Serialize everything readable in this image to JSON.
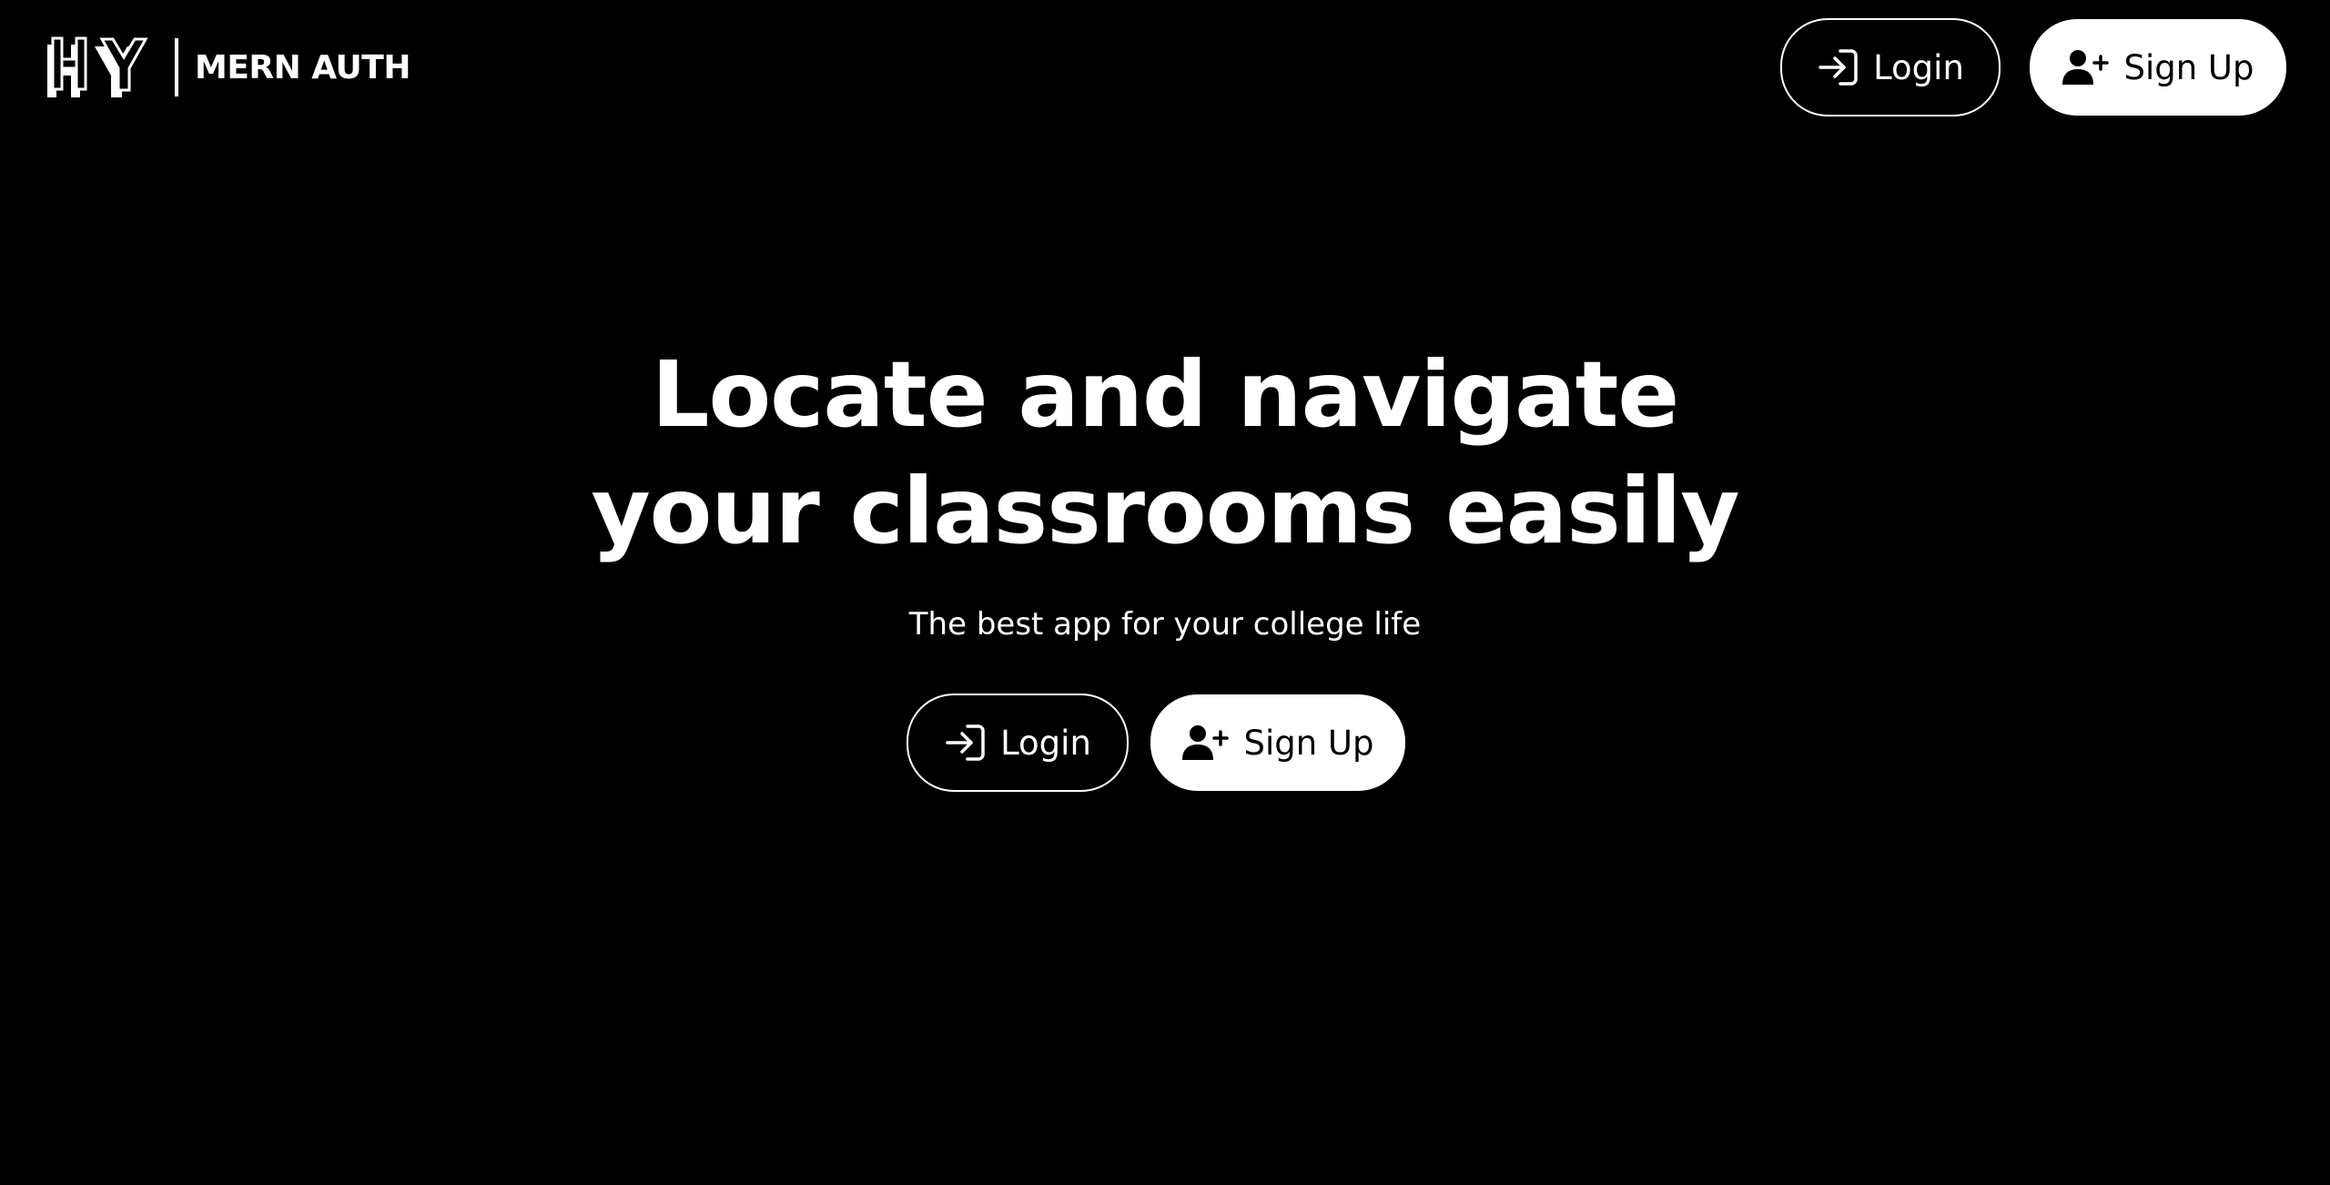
{
  "header": {
    "brand_logo": "HY",
    "brand_name": "MERN AUTH",
    "login_label": "Login",
    "signup_label": "Sign Up",
    "login_icon": "login-icon",
    "signup_icon": "user-plus-icon"
  },
  "hero": {
    "title_line1": "Locate and navigate",
    "title_line2": "your classrooms easily",
    "subtitle": "The best app for your college life",
    "login_label": "Login",
    "signup_label": "Sign Up"
  },
  "colors": {
    "background": "#000000",
    "foreground": "#ffffff"
  }
}
